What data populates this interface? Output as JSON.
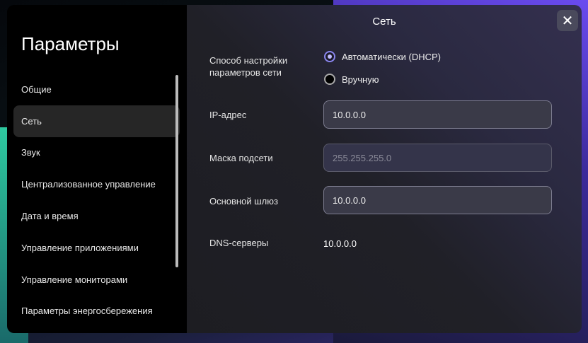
{
  "sidebar": {
    "title": "Параметры",
    "items": [
      {
        "label": "Общие"
      },
      {
        "label": "Сеть"
      },
      {
        "label": "Звук"
      },
      {
        "label": "Централизованное управление"
      },
      {
        "label": "Дата и время"
      },
      {
        "label": "Управление приложениями"
      },
      {
        "label": "Управление мониторами"
      },
      {
        "label": "Параметры энергосбережения"
      }
    ],
    "active_index": 1
  },
  "main": {
    "title": "Сеть",
    "method": {
      "label": "Способ настройки параметров сети",
      "options": [
        "Автоматически (DHCP)",
        "Вручную"
      ],
      "selected": "Автоматически (DHCP)"
    },
    "ip": {
      "label": "IP-адрес",
      "value": "10.0.0.0"
    },
    "mask": {
      "label": "Маска подсети",
      "placeholder": "255.255.255.0"
    },
    "gateway": {
      "label": "Основной шлюз",
      "value": "10.0.0.0"
    },
    "dns": {
      "label": "DNS-серверы",
      "value": "10.0.0.0"
    }
  },
  "close_icon": "close-icon"
}
